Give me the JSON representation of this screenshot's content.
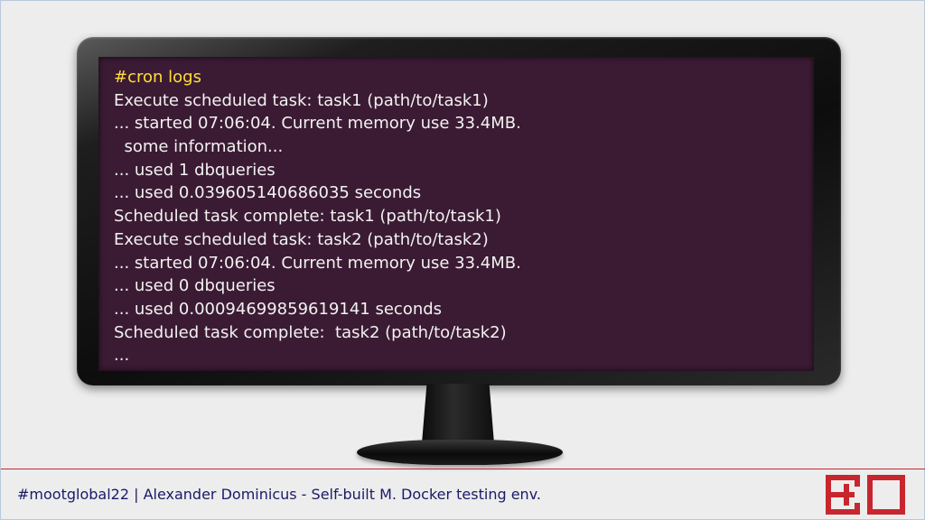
{
  "screen": {
    "lines": [
      "#cron logs",
      "Execute scheduled task: task1 (path/to/task1)",
      "... started 07:06:04. Current memory use 33.4MB.",
      "  some information...",
      "... used 1 dbqueries",
      "... used 0.039605140686035 seconds",
      "Scheduled task complete: task1 (path/to/task1)",
      "Execute scheduled task: task2 (path/to/task2)",
      "... started 07:06:04. Current memory use 33.4MB.",
      "... used 0 dbqueries",
      "... used 0.00094699859619141 seconds",
      "Scheduled task complete:  task2 (path/to/task2)",
      "..."
    ]
  },
  "footer": {
    "text": "#mootglobal22 | Alexander Dominicus - Self-built M. Docker testing env.",
    "logo_icon": "bo-logo-icon"
  },
  "colors": {
    "screen_bg": "#3b1b33",
    "title_text": "#ffde3a",
    "log_text": "#f2f2f2",
    "accent_red": "#c8262f",
    "footer_text": "#1a1a6a"
  }
}
